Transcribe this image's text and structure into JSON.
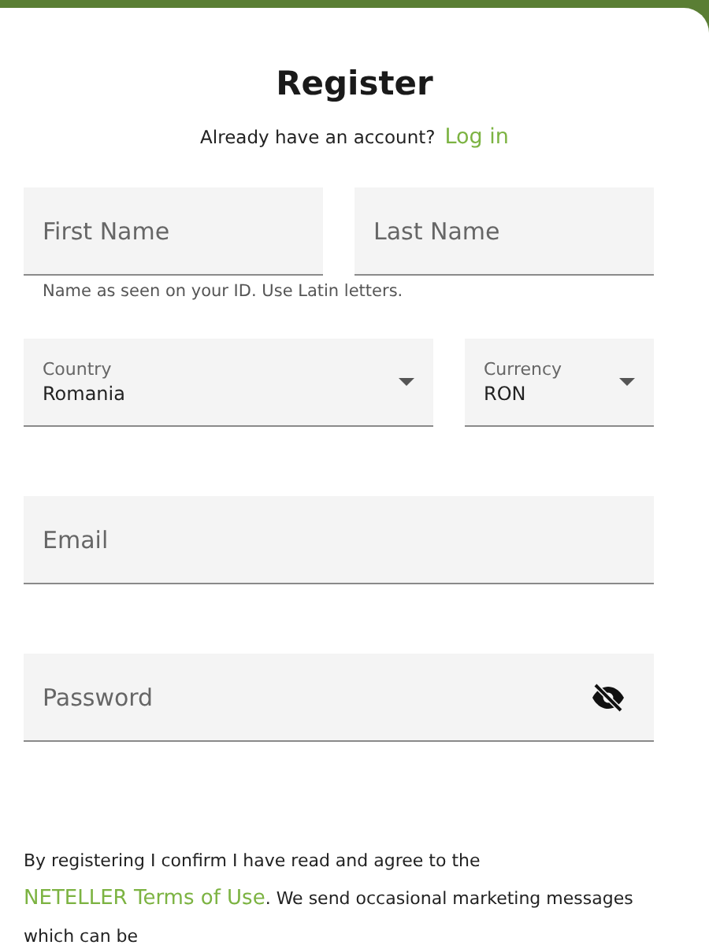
{
  "title": "Register",
  "login_prompt": {
    "text": "Already have an account?",
    "link": "Log in"
  },
  "name_fields": [
    {
      "kind": "text",
      "placeholder": "First Name"
    },
    {
      "kind": "text",
      "placeholder": "Last Name"
    }
  ],
  "name_hint": "Name as seen on your ID. Use Latin letters.",
  "select_fields": [
    {
      "kind": "select",
      "label": "Country",
      "value": "Romania"
    },
    {
      "kind": "select",
      "label": "Currency",
      "value": "RON"
    }
  ],
  "fields": [
    {
      "kind": "text",
      "placeholder": "Email"
    },
    {
      "kind": "password",
      "placeholder": "Password"
    }
  ],
  "terms": {
    "before": "By registering I confirm I have read and agree to the",
    "link": "NETELLER Terms of Use",
    "after": ". We send occasional marketing messages which can be"
  }
}
